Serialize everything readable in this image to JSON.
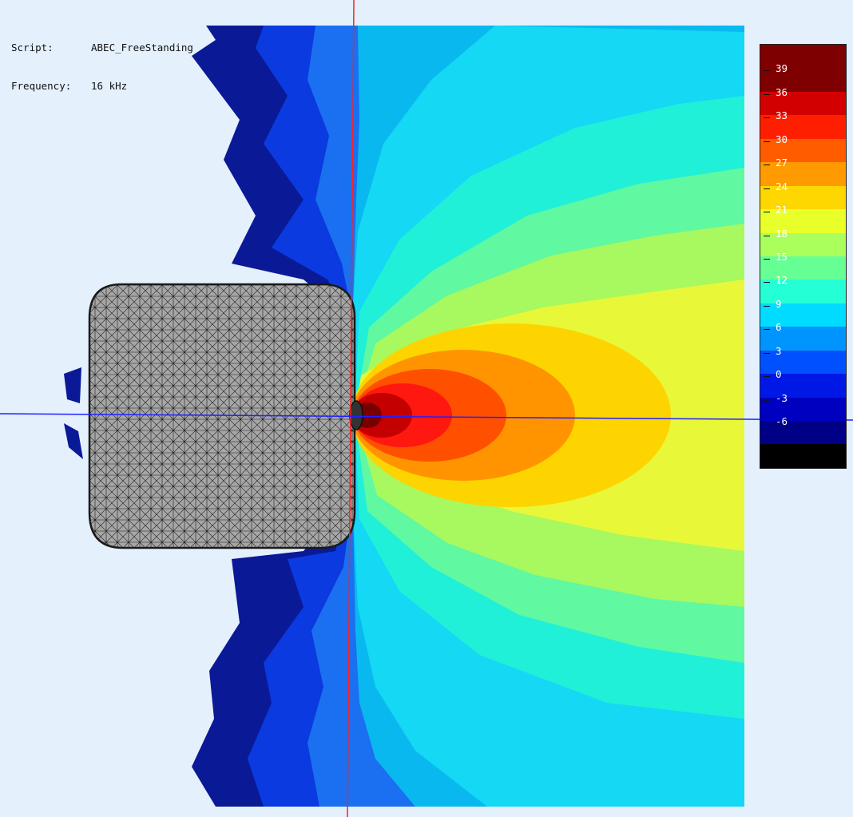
{
  "info": {
    "script_label": "Script:",
    "script_value": "ABEC_FreeStanding",
    "frequency_label": "Frequency:",
    "frequency_value": "16 kHz"
  },
  "colorbar": {
    "bands": [
      {
        "color": "#7f0000",
        "label": ""
      },
      {
        "color": "#7f0000",
        "label": "39"
      },
      {
        "color": "#d20000",
        "label": "36"
      },
      {
        "color": "#ff1f00",
        "label": "33"
      },
      {
        "color": "#ff5c00",
        "label": "30"
      },
      {
        "color": "#ff9a00",
        "label": "27"
      },
      {
        "color": "#ffd700",
        "label": "24"
      },
      {
        "color": "#e8ff29",
        "label": "21"
      },
      {
        "color": "#aaff5c",
        "label": "18"
      },
      {
        "color": "#66ff94",
        "label": "15"
      },
      {
        "color": "#24ffd6",
        "label": "12"
      },
      {
        "color": "#00dcff",
        "label": "9"
      },
      {
        "color": "#0094ff",
        "label": "6"
      },
      {
        "color": "#0050ff",
        "label": "3"
      },
      {
        "color": "#0018e6",
        "label": "0"
      },
      {
        "color": "#0000c0",
        "label": "-3"
      },
      {
        "color": "#000087",
        "label": "-6"
      },
      {
        "color": "#000000",
        "label": ""
      }
    ]
  },
  "field_colors": {
    "background": "#e4f0fc",
    "deep_blue": "#0a1a96",
    "blue": "#0a3ae0",
    "mid_blue": "#1a70f0",
    "sky": "#0ab8f0",
    "cyan": "#14d8f4",
    "aqua": "#20f0d8",
    "green": "#60f8a0",
    "lime": "#a8f860",
    "yellow": "#e8f838",
    "gold": "#fdd400",
    "orange": "#ff9400",
    "red_orange": "#ff5000",
    "red": "#ff1810",
    "dark_red": "#c40000",
    "maroon": "#780000"
  },
  "speaker": {
    "fill": "#a6a6a6",
    "mesh": "#1a1a1a"
  },
  "axes": {
    "vertical_color": "#ff2020",
    "horizontal_color": "#2020ff"
  }
}
